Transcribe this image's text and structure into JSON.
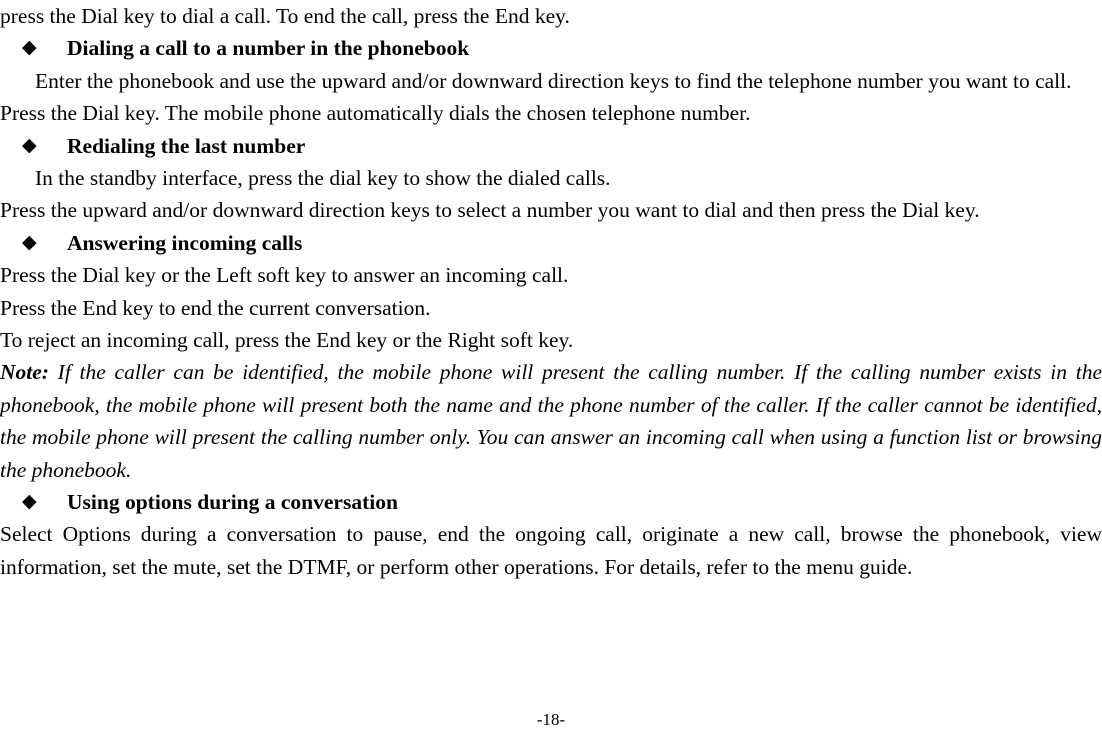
{
  "document": {
    "page_number_label": "-18-",
    "bullet_glyph": "◆",
    "blocks": [
      {
        "kind": "paragraph-line",
        "name": "intro-continuation-line",
        "text": "press the Dial key to dial a call. To end the call, press the End key."
      },
      {
        "kind": "bullet-heading",
        "name": "heading-dialing-a-call-to-a-number-in-the-phonebook",
        "text": "Dialing a call to a number in the phonebook"
      },
      {
        "kind": "paragraph-justified-indent",
        "name": "paragraph-enter-the-phonebook",
        "text": "Enter the phonebook and use the upward and/or downward direction keys to find the telephone number you want to call."
      },
      {
        "kind": "paragraph-line",
        "name": "line-press-dial-key-automatic",
        "text": "Press the Dial key. The mobile phone automatically dials the chosen telephone number."
      },
      {
        "kind": "bullet-heading",
        "name": "heading-redialing-the-last-number",
        "text": "Redialing the last number"
      },
      {
        "kind": "paragraph-line-indent",
        "name": "line-in-the-standby-interface",
        "text": "In the standby interface, press the dial key to show the dialed calls."
      },
      {
        "kind": "paragraph-justified",
        "name": "paragraph-press-upward-downward",
        "text": "Press the upward and/or downward direction keys to select a number you want to dial and then press the Dial key."
      },
      {
        "kind": "bullet-heading",
        "name": "heading-answering-incoming-calls",
        "text": "Answering incoming calls"
      },
      {
        "kind": "paragraph-line",
        "name": "line-press-dial-or-left-soft-key",
        "text": "Press the Dial key or the Left soft key to answer an incoming call."
      },
      {
        "kind": "paragraph-line",
        "name": "line-press-end-key-to-end",
        "text": "Press the End key to end the current conversation."
      },
      {
        "kind": "paragraph-line",
        "name": "line-to-reject-an-incoming-call",
        "text": "To reject an incoming call, press the End key or the Right soft key."
      },
      {
        "kind": "paragraph-note",
        "name": "paragraph-note-caller-identification",
        "lead": "Note:",
        "text": " If the caller can be identified, the mobile phone will present the calling number. If the calling number exists in the phonebook, the mobile phone will present both the name and the phone number of the caller. If the caller cannot be identified, the mobile phone will present the calling number only. You can answer an incoming call when using a function list or browsing the phonebook."
      },
      {
        "kind": "bullet-heading",
        "name": "heading-using-options-during-a-conversation",
        "text": "Using options during a conversation"
      },
      {
        "kind": "paragraph-justified",
        "name": "paragraph-select-options-during-conversation",
        "text": "Select Options during a conversation to pause, end the ongoing call, originate a new call, browse the phonebook, view information, set the mute, set the DTMF, or perform other operations. For details, refer to the menu guide."
      }
    ]
  }
}
